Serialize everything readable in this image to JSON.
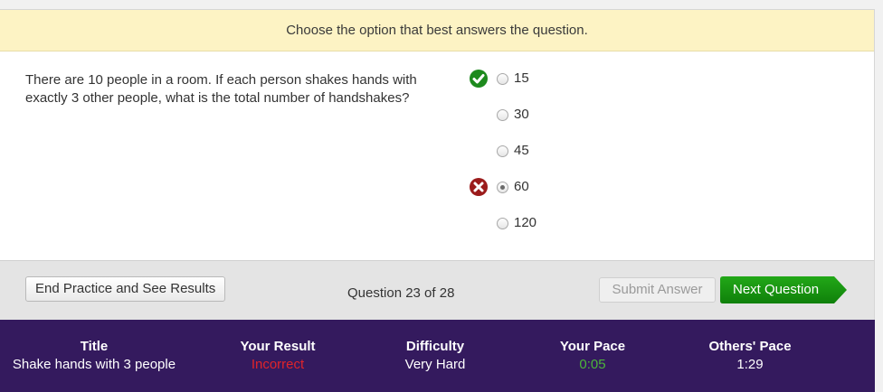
{
  "instruction": "Choose the option that best answers the question.",
  "question": {
    "text": "There are 10 people in a room. If each person shakes hands with exactly 3 other people, what is the total number of handshakes?",
    "options": [
      {
        "label": "15",
        "mark": "correct",
        "selected": false
      },
      {
        "label": "30",
        "mark": "none",
        "selected": false
      },
      {
        "label": "45",
        "mark": "none",
        "selected": false
      },
      {
        "label": "60",
        "mark": "incorrect",
        "selected": true
      },
      {
        "label": "120",
        "mark": "none",
        "selected": false
      }
    ]
  },
  "footer": {
    "end_button": "End Practice and See Results",
    "counter": "Question 23 of 28",
    "submit_button": "Submit Answer",
    "next_button": "Next Question"
  },
  "stats": {
    "title": {
      "label": "Title",
      "value": "Shake hands with 3 people"
    },
    "result": {
      "label": "Your Result",
      "value": "Incorrect"
    },
    "difficulty": {
      "label": "Difficulty",
      "value": "Very Hard"
    },
    "your_pace": {
      "label": "Your Pace",
      "value": "0:05"
    },
    "others_pace": {
      "label": "Others' Pace",
      "value": "1:29"
    }
  },
  "colors": {
    "correct": "#1d8a1d",
    "incorrect": "#9b1b1b",
    "next_button": "#16910f",
    "stats_background": "#341a5e",
    "instruction_background": "#fdf3c4"
  },
  "icons": {
    "correct": "check-circle-icon",
    "incorrect": "x-circle-icon",
    "next": "arrow-right-icon"
  }
}
